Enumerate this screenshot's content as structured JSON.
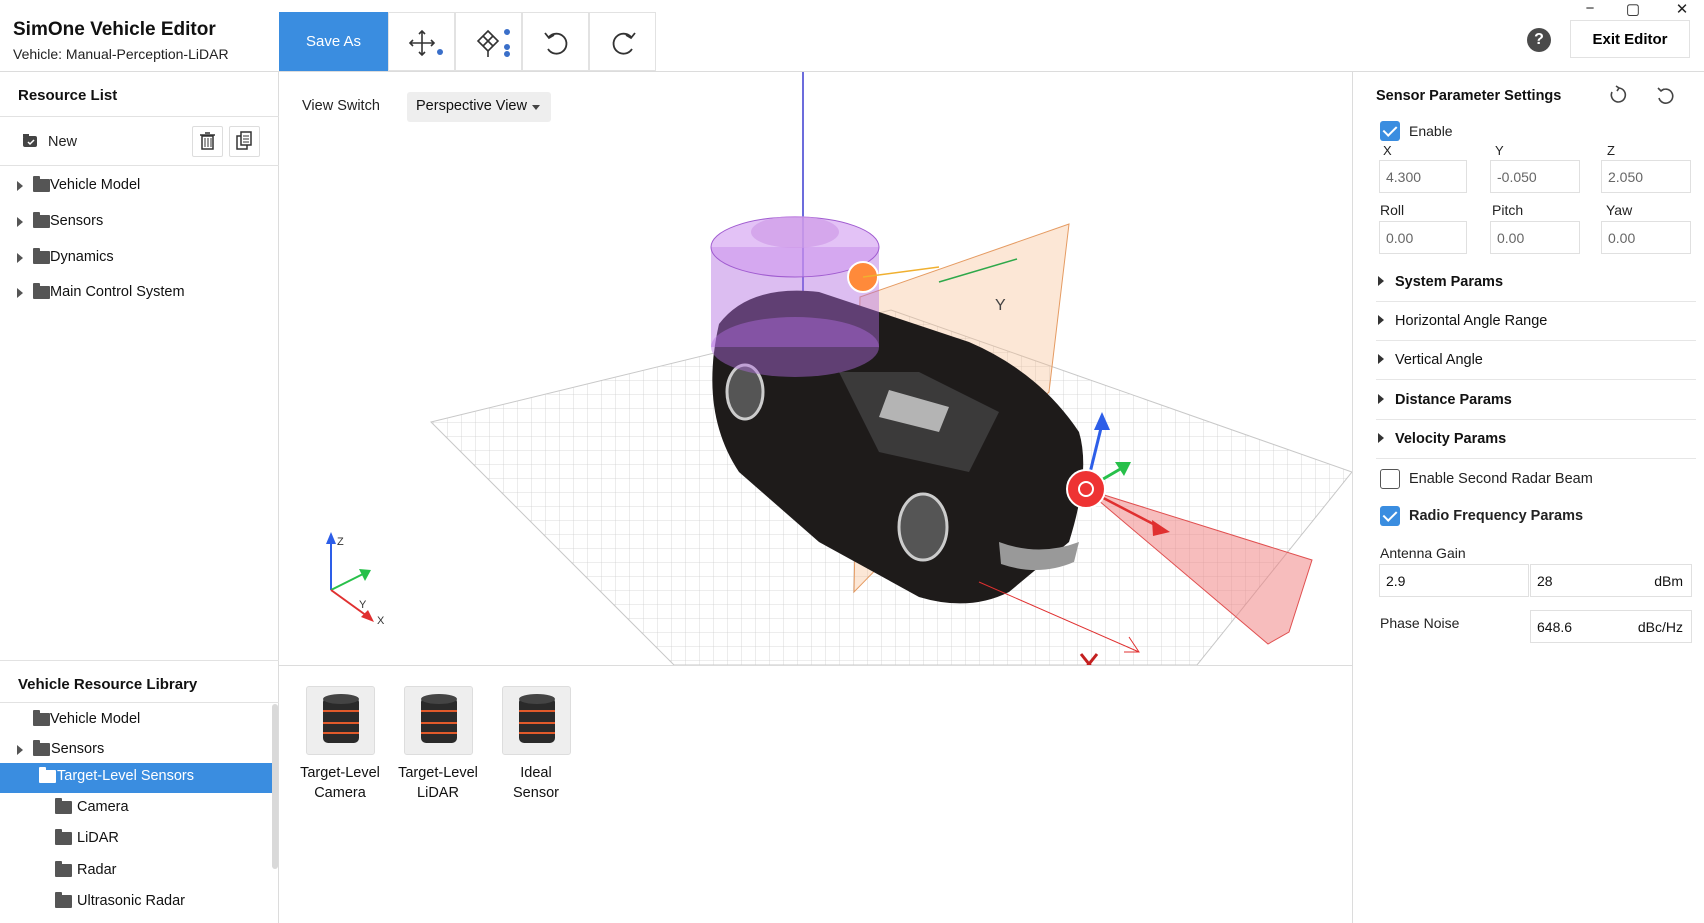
{
  "app": {
    "title": "SimOne Vehicle Editor",
    "vehicle_line": "Vehicle: Manual-Perception-LiDAR"
  },
  "toolbar": {
    "save_as": "Save As",
    "help": "?",
    "exit": "Exit Editor"
  },
  "window": {
    "minimize": "−",
    "restore": "▢",
    "close": "✕"
  },
  "resource_list": {
    "title": "Resource List",
    "new_label": "New",
    "items": [
      {
        "label": "Vehicle Model"
      },
      {
        "label": "Sensors"
      },
      {
        "label": "Dynamics"
      },
      {
        "label": "Main Control System"
      }
    ]
  },
  "vehicle_library": {
    "title": "Vehicle Resource Library",
    "items": [
      {
        "label": "Vehicle Model"
      },
      {
        "label": "Sensors"
      },
      {
        "label": "Target-Level Sensors",
        "selected": true
      },
      {
        "label": "Camera"
      },
      {
        "label": "LiDAR"
      },
      {
        "label": "Radar"
      },
      {
        "label": "Ultrasonic Radar"
      }
    ]
  },
  "viewport": {
    "view_switch_label": "View Switch",
    "view_mode": "Perspective View",
    "axis_labels": {
      "z": "Z",
      "y": "Y",
      "x": "X"
    },
    "gizmo_label": "Y"
  },
  "library_items": [
    {
      "line1": "Target-Level",
      "line2": "Camera"
    },
    {
      "line1": "Target-Level",
      "line2": "LiDAR"
    },
    {
      "line1": "Ideal",
      "line2": "Sensor"
    }
  ],
  "sensor_settings": {
    "title": "Sensor Parameter Settings",
    "enable_label": "Enable",
    "enable_checked": true,
    "x_label": "X",
    "y_label": "Y",
    "z_label": "Z",
    "x": "4.300",
    "y": "-0.050",
    "z": "2.050",
    "roll_label": "Roll",
    "pitch_label": "Pitch",
    "yaw_label": "Yaw",
    "roll": "0.00",
    "pitch": "0.00",
    "yaw": "0.00",
    "sections": [
      {
        "label": "System Params"
      },
      {
        "label": "Horizontal Angle Range"
      },
      {
        "label": "Vertical Angle"
      },
      {
        "label": "Distance Params"
      },
      {
        "label": "Velocity Params"
      }
    ],
    "second_beam_label": "Enable Second Radar Beam",
    "second_beam_checked": false,
    "rf_label": "Radio Frequency Params",
    "rf_checked": true,
    "antenna_gain_label": "Antenna Gain",
    "antenna_gain_value": "2.9",
    "antenna_gain_value2": "28",
    "antenna_gain_unit": "dBm",
    "phase_noise_label": "Phase Noise",
    "phase_noise_value": "648.6",
    "phase_noise_unit": "dBc/Hz"
  }
}
